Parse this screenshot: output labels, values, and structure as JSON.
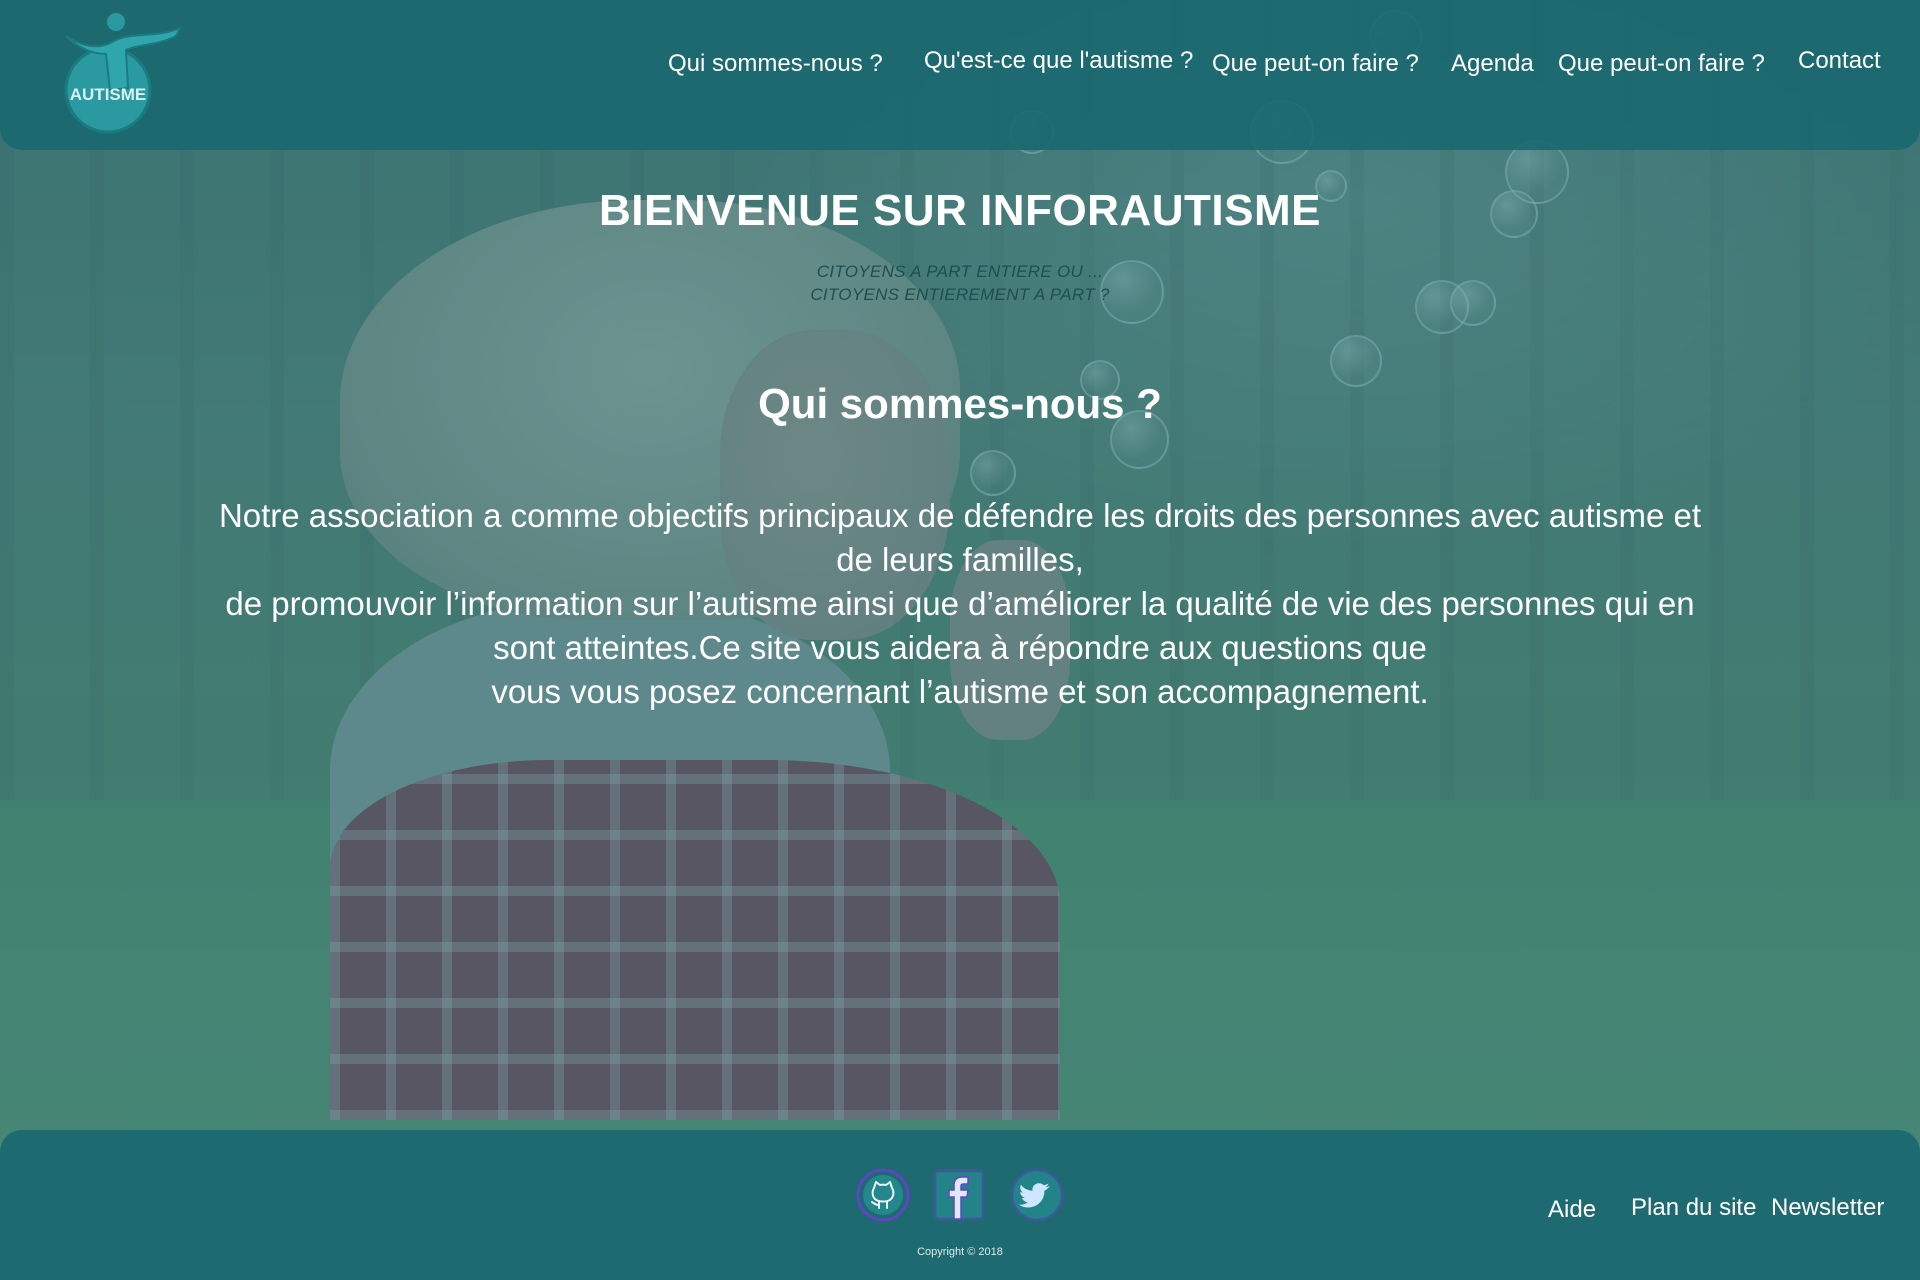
{
  "header": {
    "logo_text": "AUTISME",
    "nav": [
      {
        "label": "Qui sommes-nous ?"
      },
      {
        "label": "Qu'est-ce que l'autisme ?"
      },
      {
        "label": "Que peut-on faire ?"
      },
      {
        "label": "Agenda"
      },
      {
        "label": "Que peut-on faire ?"
      },
      {
        "label": "Contact"
      }
    ]
  },
  "main": {
    "title": "BIENVENUE SUR INFORAUTISME",
    "tagline_line1": "CITOYENS A PART ENTIERE OU ...",
    "tagline_line2": "CITOYENS ENTIEREMENT A PART ?",
    "section_title": "Qui sommes-nous ?",
    "paragraph": [
      "Notre association a comme objectifs principaux de défendre les droits des personnes avec autisme et",
      "de leurs familles,",
      "de promouvoir l’information sur l’autisme ainsi que d’améliorer la qualité de vie des personnes qui en",
      "sont atteintes.Ce site vous aidera à répondre aux questions que",
      "vous vous posez concernant l’autisme et son accompagnement."
    ]
  },
  "footer": {
    "social": [
      {
        "icon": "github-icon"
      },
      {
        "icon": "facebook-icon"
      },
      {
        "icon": "twitter-icon"
      }
    ],
    "copyright": "Copyright © 2018",
    "links": [
      {
        "label": "Aide"
      },
      {
        "label": "Plan du site"
      },
      {
        "label": "Newsletter"
      }
    ]
  },
  "colors": {
    "header_bg": "#186870",
    "overlay": "#1f6e76",
    "text": "#ffffff",
    "tagline": "#1f4e50",
    "icon_accent": "#6a3fd0"
  }
}
